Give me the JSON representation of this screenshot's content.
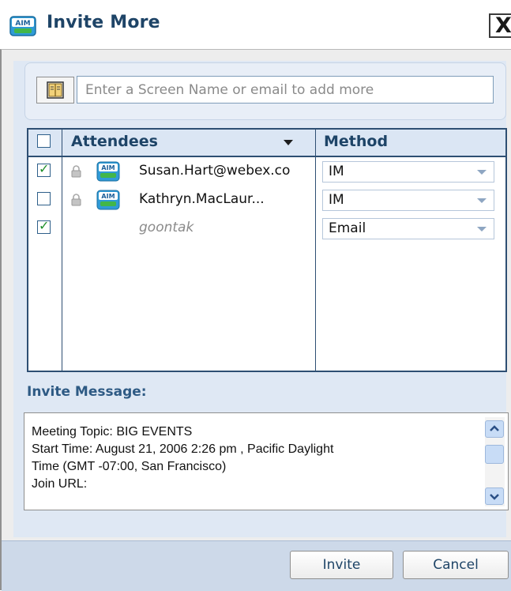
{
  "dialog": {
    "title": "Invite More",
    "close_label": "X"
  },
  "search": {
    "placeholder": "Enter a Screen Name or email to add more"
  },
  "table": {
    "columns": {
      "attendees": "Attendees",
      "method": "Method"
    },
    "rows": [
      {
        "checked": true,
        "name": "Susan.Hart@webex.co",
        "method": "IM",
        "has_icons": true
      },
      {
        "checked": false,
        "name": "Kathryn.MacLaur...",
        "method": "IM",
        "has_icons": true
      },
      {
        "checked": true,
        "name": "goontak",
        "method": "Email",
        "has_icons": false
      }
    ]
  },
  "invite_message": {
    "label": "Invite Message:",
    "lines": [
      "Meeting Topic: BIG EVENTS",
      "Start Time: August 21, 2006 2:26 pm , Pacific Daylight",
      "Time (GMT -07:00, San Francisco)",
      "Join URL:"
    ]
  },
  "footer": {
    "invite_label": "Invite",
    "cancel_label": "Cancel"
  },
  "colors": {
    "accent": "#1e4467",
    "grid_border": "#2e4f73",
    "footer": "#cdd9e9"
  }
}
